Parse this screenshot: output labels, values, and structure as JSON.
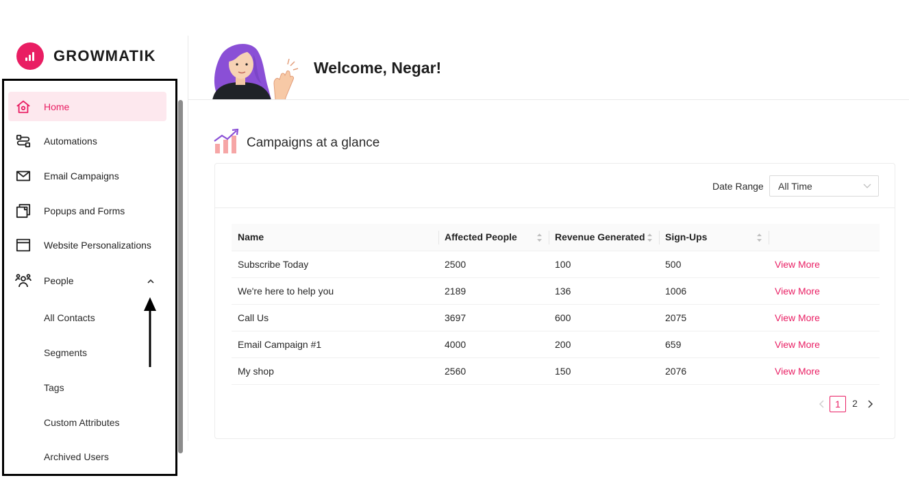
{
  "brand": {
    "name": "GROWMATIK",
    "color": "#e91e63"
  },
  "sidebar": {
    "items": [
      {
        "label": "Home",
        "icon": "home-icon",
        "active": true
      },
      {
        "label": "Automations",
        "icon": "automation-icon"
      },
      {
        "label": "Email Campaigns",
        "icon": "mail-icon"
      },
      {
        "label": "Popups and Forms",
        "icon": "popup-icon"
      },
      {
        "label": "Website Personalizations",
        "icon": "browser-window-icon"
      },
      {
        "label": "People",
        "icon": "people-icon",
        "expanded": true
      }
    ],
    "people_subitems": [
      "All Contacts",
      "Segments",
      "Tags",
      "Custom Attributes",
      "Archived Users"
    ]
  },
  "header": {
    "welcome": "Welcome, Negar!"
  },
  "section": {
    "title": "Campaigns at a glance",
    "icon": "trending-chart-icon"
  },
  "filter": {
    "label": "Date Range",
    "value": "All Time"
  },
  "table": {
    "columns": [
      "Name",
      "Affected People",
      "Revenue Generated",
      "Sign-Ups",
      ""
    ],
    "rows": [
      {
        "name": "Subscribe Today",
        "affected": "2500",
        "revenue": "100",
        "signups": "500",
        "action": "View More"
      },
      {
        "name": "We're here to help you",
        "affected": "2189",
        "revenue": "136",
        "signups": "1006",
        "action": "View More"
      },
      {
        "name": "Call Us",
        "affected": "3697",
        "revenue": "600",
        "signups": "2075",
        "action": "View More"
      },
      {
        "name": "Email Campaign #1",
        "affected": "4000",
        "revenue": "200",
        "signups": "659",
        "action": "View More"
      },
      {
        "name": "My shop",
        "affected": "2560",
        "revenue": "150",
        "signups": "2076",
        "action": "View More"
      }
    ]
  },
  "pagination": {
    "pages": [
      "1",
      "2"
    ],
    "current": "1"
  },
  "colors": {
    "accent": "#e91e63",
    "active_bg": "#fde8ee"
  }
}
